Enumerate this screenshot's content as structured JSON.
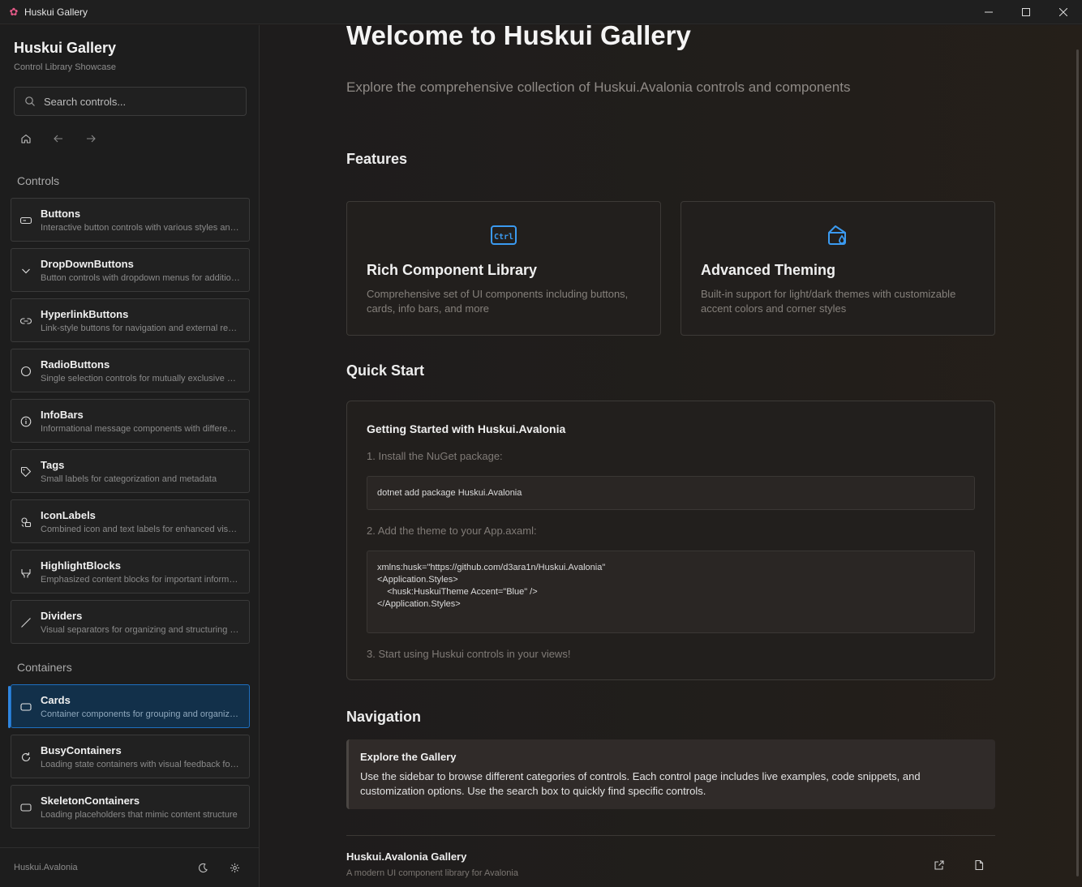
{
  "window": {
    "title": "Huskui Gallery"
  },
  "sidebar": {
    "title": "Huskui Gallery",
    "subtitle": "Control Library Showcase",
    "search_placeholder": "Search controls...",
    "sections": {
      "controls": "Controls",
      "containers": "Containers"
    },
    "controls": [
      {
        "name": "Buttons",
        "desc": "Interactive button controls with various styles and states",
        "icon": "button-icon"
      },
      {
        "name": "DropDownButtons",
        "desc": "Button controls with dropdown menus for additional actions",
        "icon": "chevron-down-icon"
      },
      {
        "name": "HyperlinkButtons",
        "desc": "Link-style buttons for navigation and external resources",
        "icon": "link-icon"
      },
      {
        "name": "RadioButtons",
        "desc": "Single selection controls for mutually exclusive options",
        "icon": "radio-icon"
      },
      {
        "name": "InfoBars",
        "desc": "Informational message components with different severities",
        "icon": "info-icon"
      },
      {
        "name": "Tags",
        "desc": "Small labels for categorization and metadata",
        "icon": "tag-icon"
      },
      {
        "name": "IconLabels",
        "desc": "Combined icon and text labels for enhanced visual communication",
        "icon": "icon-label-icon"
      },
      {
        "name": "HighlightBlocks",
        "desc": "Emphasized content blocks for important information",
        "icon": "highlighter-icon"
      },
      {
        "name": "Dividers",
        "desc": "Visual separators for organizing and structuring content",
        "icon": "divider-icon"
      }
    ],
    "containers": [
      {
        "name": "Cards",
        "desc": "Container components for grouping and organizing content",
        "icon": "card-icon",
        "active": true
      },
      {
        "name": "BusyContainers",
        "desc": "Loading state containers with visual feedback for operations",
        "icon": "refresh-icon"
      },
      {
        "name": "SkeletonContainers",
        "desc": "Loading placeholders that mimic content structure",
        "icon": "skeleton-icon"
      }
    ],
    "footer": {
      "version": "Huskui.Avalonia"
    }
  },
  "main": {
    "title": "Welcome to Huskui Gallery",
    "lead": "Explore the comprehensive collection of Huskui.Avalonia controls and components",
    "features_heading": "Features",
    "features": [
      {
        "title": "Rich Component Library",
        "desc": "Comprehensive set of UI components including buttons, cards, info bars, and more",
        "icon": "ctrl-key-icon"
      },
      {
        "title": "Advanced Theming",
        "desc": "Built-in support for light/dark themes with customizable accent colors and corner styles",
        "icon": "paint-bucket-icon"
      }
    ],
    "quickstart_heading": "Quick Start",
    "quickstart": {
      "title": "Getting Started with Huskui.Avalonia",
      "step1": "1. Install the NuGet package:",
      "code1": "dotnet add package Huskui.Avalonia",
      "step2": "2. Add the theme to your App.axaml:",
      "code2": [
        "xmlns:husk=\"https://github.com/d3ara1n/Huskui.Avalonia\"",
        "",
        "<Application.Styles>",
        "    <husk:HuskuiTheme Accent=\"Blue\" />",
        "</Application.Styles>"
      ],
      "step3": "3. Start using Huskui controls in your views!"
    },
    "navigation_heading": "Navigation",
    "navigation": {
      "title": "Explore the Gallery",
      "desc": "Use the sidebar to browse different categories of controls. Each control page includes live examples, code snippets, and customization options. Use the search box to quickly find specific controls."
    },
    "footer": {
      "title": "Huskui.Avalonia Gallery",
      "subtitle": "A modern UI component library for Avalonia"
    }
  },
  "colors": {
    "accent": "#2f86e0",
    "feature_icon": "#3b9af0",
    "active_item_bg": "#12304a"
  }
}
